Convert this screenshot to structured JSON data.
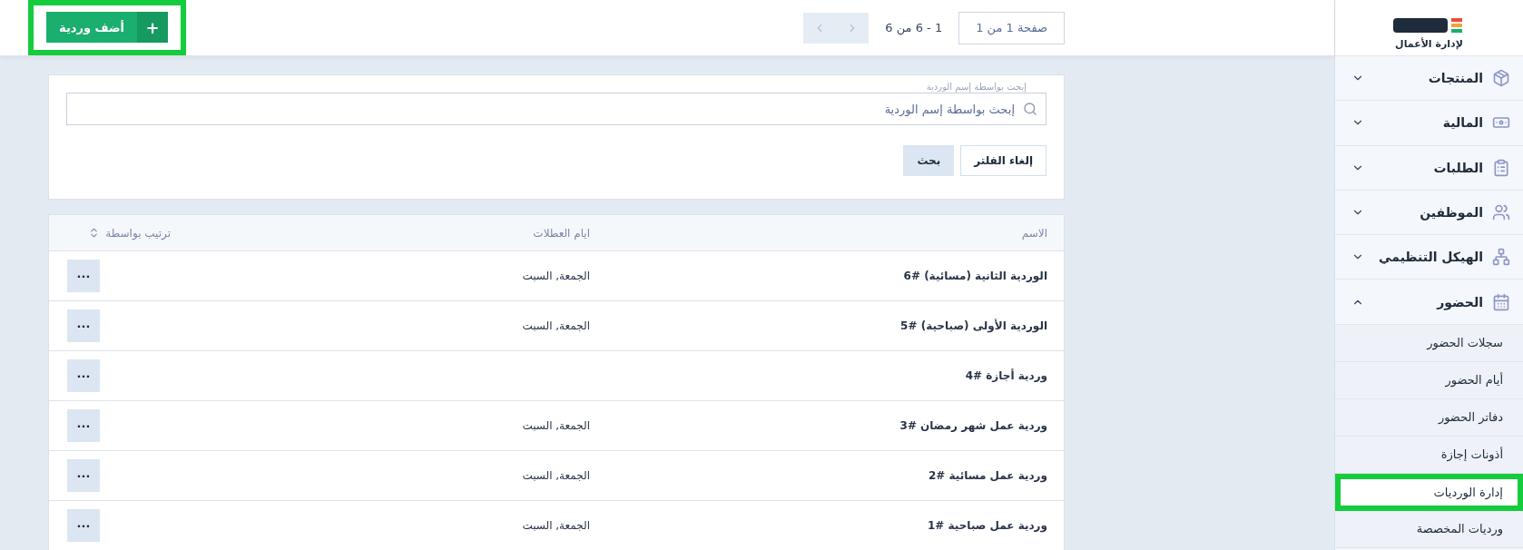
{
  "top_bar": {
    "add_button": {
      "icon": "+",
      "label": "أضف وردية",
      "highlighted": true
    },
    "pagination": {
      "page": "صفحة 1 من 1",
      "range": "1 - 6 من 6",
      "prev_disabled": true,
      "next_disabled": true
    }
  },
  "search": {
    "label": "إبحث بواسطة إسم الوردية",
    "placeholder": "إبحث بواسطة إسم الوردية",
    "buttons": [
      {
        "kind": "secondary",
        "label": "إلغاء الفلتر"
      },
      {
        "kind": "primary",
        "label": "بحث"
      }
    ]
  },
  "table": {
    "columns": [
      "الاسم",
      "ايام العطلات",
      "ترتيب بواسطة"
    ],
    "rows": [
      {
        "name": "الوردية الثانية (مسائية) #6",
        "holidays": "الجمعة, السبت",
        "action": "···"
      },
      {
        "name": "الوردية الأولى (صباحية) #5",
        "holidays": "الجمعة, السبت",
        "action": "···"
      },
      {
        "name": "وردية أجازة #4",
        "action": "···"
      },
      {
        "name": "وردية عمل شهر رمضان #3",
        "holidays": "الجمعة, السبت",
        "action": "···"
      },
      {
        "name": "وردية عمل مسائية #2",
        "holidays": "الجمعة, السبت",
        "action": "···"
      },
      {
        "name": "وردية عمل صباحية #1",
        "holidays": "الجمعة, السبت",
        "action": "···"
      }
    ]
  },
  "sidebar": {
    "tagline": "لإدارة الأعمال",
    "items": [
      {
        "kind": "products",
        "label": "المنتجات",
        "expanded": false
      },
      {
        "kind": "finance",
        "label": "المالية",
        "expanded": false
      },
      {
        "kind": "orders",
        "label": "الطلبات",
        "expanded": false
      },
      {
        "kind": "staff",
        "label": "الموظفين",
        "expanded": false
      },
      {
        "kind": "structure",
        "label": "الهيكل التنظيمي",
        "expanded": false
      },
      {
        "kind": "attendance",
        "label": "الحضور",
        "expanded": true,
        "children": [
          {
            "label": "سجلات الحضور",
            "highlighted": false
          },
          {
            "label": "أيام الحضور",
            "highlighted": false
          },
          {
            "label": "دفاتر الحضور",
            "highlighted": false
          },
          {
            "label": "أذونات إجازة",
            "highlighted": false
          },
          {
            "label": "إدارة الورديات",
            "highlighted": true
          },
          {
            "label": "ورديات المخصصة",
            "highlighted": false
          }
        ]
      }
    ]
  }
}
